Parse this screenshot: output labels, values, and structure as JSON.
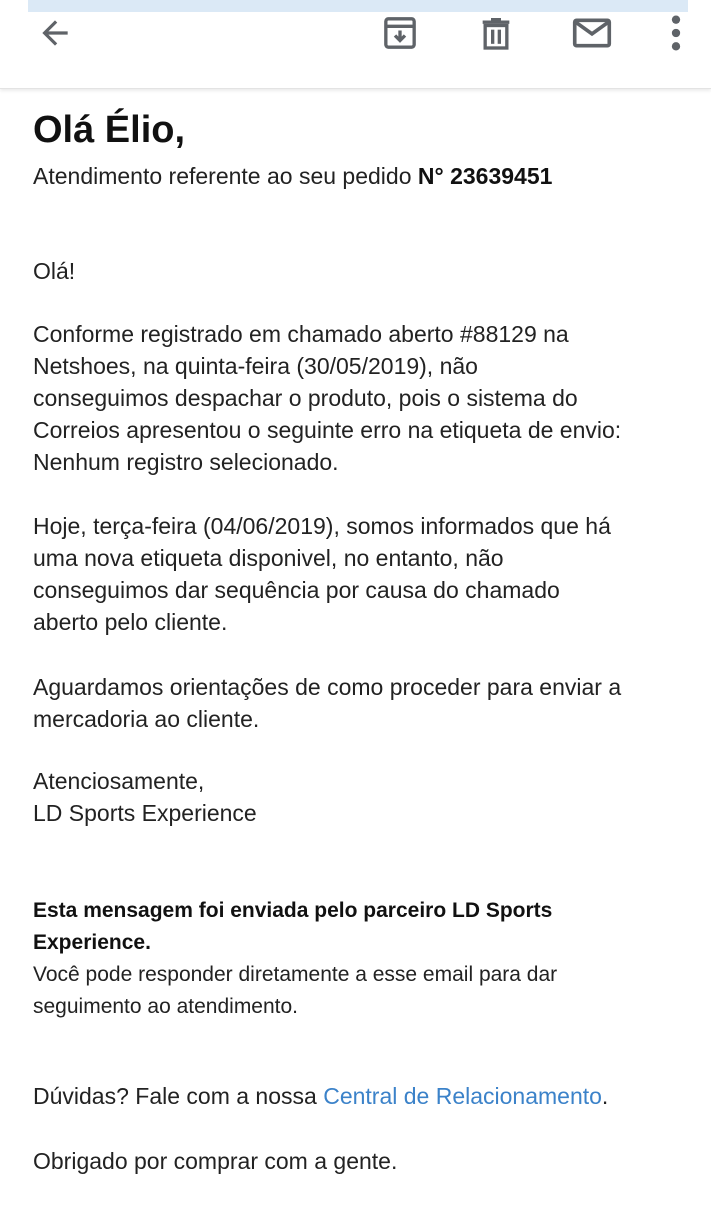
{
  "toolbar": {
    "back_icon": "arrow-left-icon",
    "archive_icon": "archive-icon",
    "delete_icon": "trash-icon",
    "mail_icon": "mail-icon",
    "more_icon": "more-vert-icon",
    "icon_color": "#5f6368"
  },
  "email": {
    "greeting": "Olá Élio,",
    "subtitle_prefix": "Atendimento referente ao seu pedido ",
    "order_number": "N° 23639451",
    "hello": "Olá!",
    "body1_lines": [
      "Conforme registrado em chamado aberto #88129 na",
      "Netshoes, na quinta-feira (30/05/2019), não",
      "conseguimos despachar o produto, pois o sistema do",
      "Correios apresentou o seguinte erro na etiqueta de envio:",
      "Nenhum registro selecionado."
    ],
    "body2_lines": [
      "Hoje, terça-feira (04/06/2019), somos informados que há",
      "uma nova etiqueta disponivel, no entanto, não",
      "conseguimos dar sequência por causa do chamado",
      "aberto pelo cliente."
    ],
    "body3_lines": [
      "Aguardamos orientações de como proceder para enviar a",
      "mercadoria ao cliente."
    ],
    "signoff": "Atenciosamente,",
    "signature": "LD Sports Experience",
    "notice_bold_lines": [
      "Esta mensagem foi enviada pelo parceiro LD Sports",
      "Experience."
    ],
    "notice_lines": [
      "Você pode responder diretamente a esse email para dar",
      "seguimento ao atendimento."
    ],
    "doubts_prefix": "Dúvidas? Fale com a nossa ",
    "doubts_link": "Central de Relacionamento",
    "doubts_suffix": ".",
    "thanks": "Obrigado por comprar com a gente.",
    "link_color": "#3b82c9"
  }
}
